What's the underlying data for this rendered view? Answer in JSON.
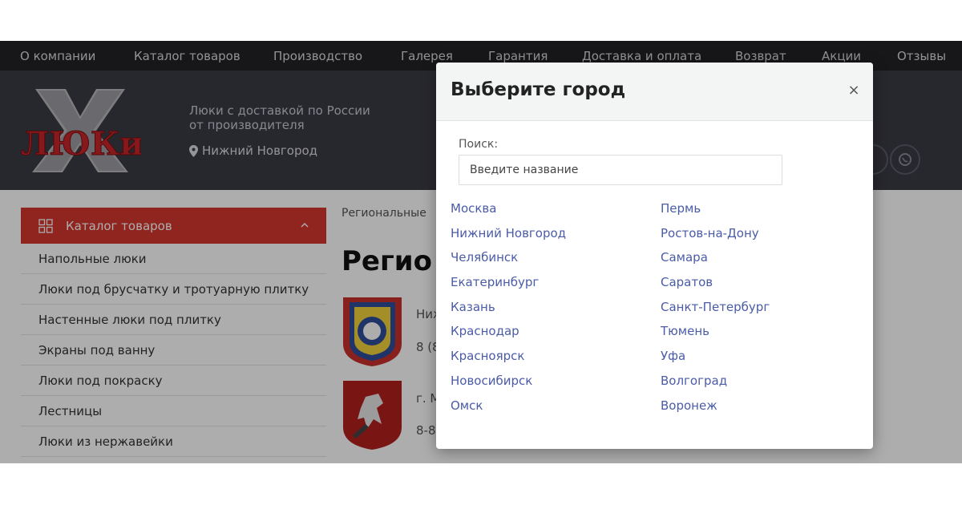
{
  "nav": {
    "items": [
      "О компании",
      "Каталог товаров",
      "Производство",
      "Галерея",
      "Гарантия",
      "Доставка и оплата",
      "Возврат",
      "Акции",
      "Отзывы"
    ]
  },
  "header": {
    "logo_text": "ЛЮКи",
    "tagline_line1": "Люки с доставкой по России",
    "tagline_line2": "от производителя",
    "city": "Нижний Новгород"
  },
  "sidebar": {
    "title": "Каталог товаров",
    "items": [
      "Напольные люки",
      "Люки под брусчатку и тротуарную плитку",
      "Настенные люки под плитку",
      "Экраны под ванну",
      "Люки под покраску",
      "Лестницы",
      "Люки из нержавейки"
    ]
  },
  "content": {
    "breadcrumbs": "Региональные",
    "title": "Регио",
    "region1_name": "Ниж",
    "region1_phone": "8 (8",
    "region2_name": "г. М",
    "region2_phone": "8-8"
  },
  "modal": {
    "title": "Выберите город",
    "close": "×",
    "search_label": "Поиск:",
    "search_placeholder": "Введите название",
    "cities_left": [
      "Москва",
      "Нижний Новгород",
      "Челябинск",
      "Екатеринбург",
      "Казань",
      "Краснодар",
      "Красноярск",
      "Новосибирск",
      "Омск"
    ],
    "cities_right": [
      "Пермь",
      "Ростов-на-Дону",
      "Самара",
      "Саратов",
      "Санкт-Петербург",
      "Тюмень",
      "Уфа",
      "Волгоград",
      "Воронеж"
    ]
  },
  "colors": {
    "nav_bg": "#232325",
    "header_bg": "#3a3a44",
    "accent": "#d4362f",
    "link": "#4a5ba8"
  }
}
